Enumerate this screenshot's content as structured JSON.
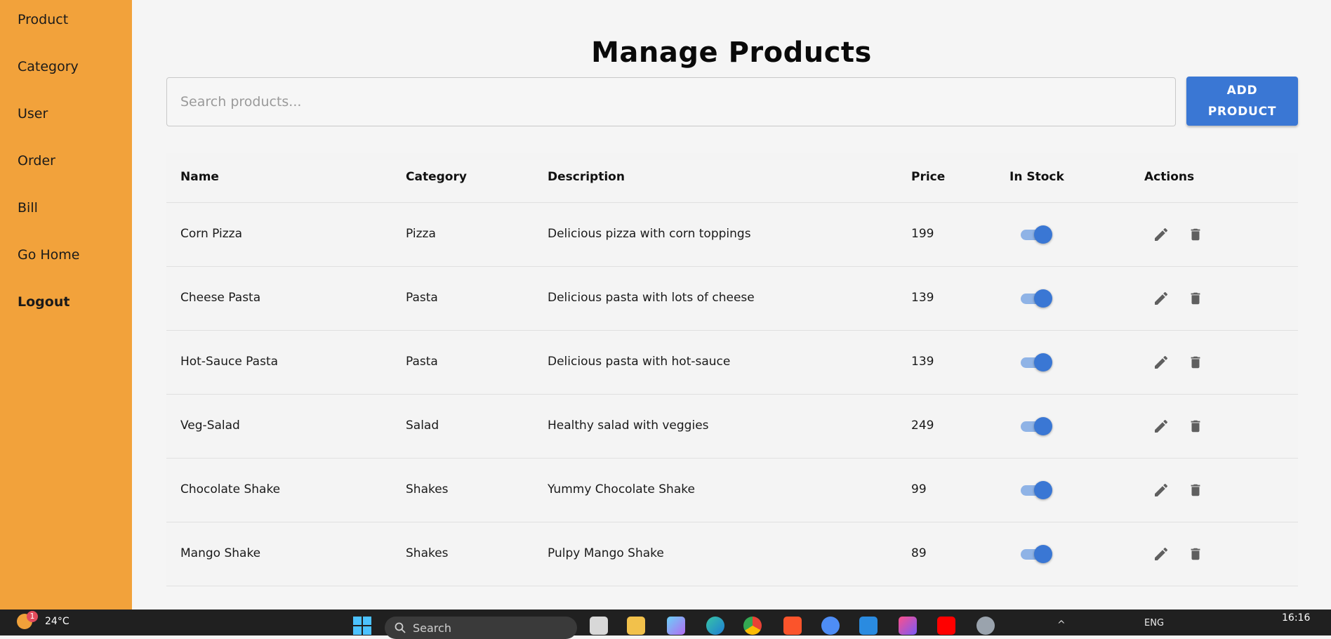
{
  "sidebar": {
    "items": [
      {
        "label": "Product"
      },
      {
        "label": "Category"
      },
      {
        "label": "User"
      },
      {
        "label": "Order"
      },
      {
        "label": "Bill"
      },
      {
        "label": "Go Home"
      },
      {
        "label": "Logout"
      }
    ]
  },
  "main": {
    "title": "Manage Products",
    "search": {
      "placeholder": "Search products...",
      "value": ""
    },
    "add_button": {
      "line1": "ADD",
      "line2": "PRODUCT"
    }
  },
  "table": {
    "headers": [
      "Name",
      "Category",
      "Description",
      "Price",
      "In Stock",
      "Actions"
    ],
    "rows": [
      {
        "name": "Corn Pizza",
        "category": "Pizza",
        "description": "Delicious pizza with corn toppings",
        "price": "199",
        "in_stock": true
      },
      {
        "name": "Cheese Pasta",
        "category": "Pasta",
        "description": "Delicious pasta with lots of cheese",
        "price": "139",
        "in_stock": true
      },
      {
        "name": "Hot-Sauce Pasta",
        "category": "Pasta",
        "description": "Delicious pasta with hot-sauce",
        "price": "139",
        "in_stock": true
      },
      {
        "name": "Veg-Salad",
        "category": "Salad",
        "description": "Healthy salad with veggies",
        "price": "249",
        "in_stock": true
      },
      {
        "name": "Chocolate Shake",
        "category": "Shakes",
        "description": "Yummy Chocolate Shake",
        "price": "99",
        "in_stock": true
      },
      {
        "name": "Mango Shake",
        "category": "Shakes",
        "description": "Pulpy Mango Shake",
        "price": "89",
        "in_stock": true
      }
    ]
  },
  "taskbar": {
    "weather_temp": "24°C",
    "weather_badge": "1",
    "search_label": "Search",
    "language": "ENG",
    "time": "16:16"
  },
  "colors": {
    "sidebar": "#f2a23b",
    "accent": "#3a77d4",
    "toggle_track": "#8fb3e6",
    "taskbar": "#202020"
  }
}
